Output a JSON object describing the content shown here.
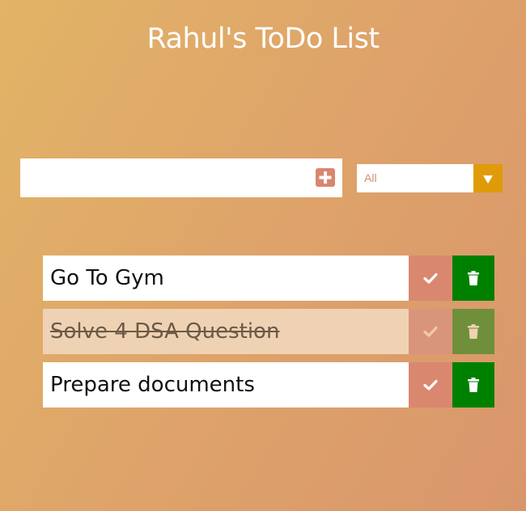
{
  "header": {
    "title": "Rahul's ToDo List"
  },
  "form": {
    "input_value": "",
    "input_placeholder": "",
    "add_icon": "plus-square-icon",
    "filter": {
      "selected": "All",
      "arrow_icon": "caret-down-icon"
    }
  },
  "todos": [
    {
      "text": "Go To Gym",
      "completed": false,
      "check_icon": "check-icon",
      "delete_icon": "trash-icon"
    },
    {
      "text": "Solve 4 DSA Question",
      "completed": true,
      "check_icon": "check-icon",
      "delete_icon": "trash-icon"
    },
    {
      "text": "Prepare documents",
      "completed": false,
      "check_icon": "check-icon",
      "delete_icon": "trash-icon"
    }
  ],
  "colors": {
    "background_start": "#e2b466",
    "background_end": "#d9966c",
    "check_button": "#d9886f",
    "delete_button": "#008000",
    "filter_arrow": "#e09b0b",
    "completed_item": "#efd2b3"
  }
}
